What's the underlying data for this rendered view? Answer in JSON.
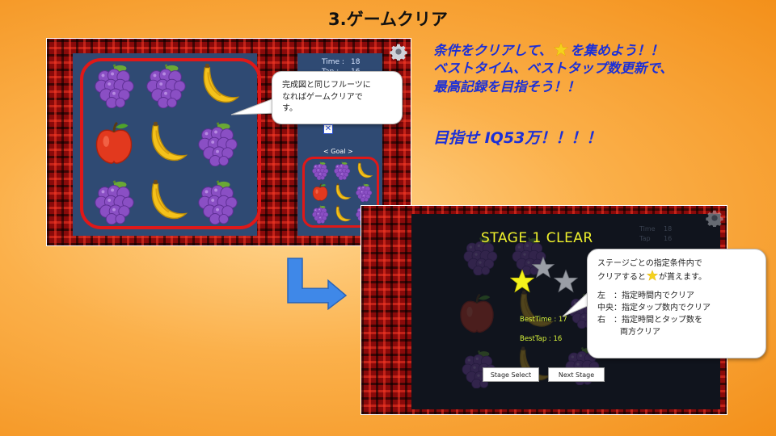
{
  "slide": {
    "title": "3.ゲームクリア",
    "tagline": {
      "line1_a": "条件をクリアして、",
      "line1_b": "を集めよう！！",
      "line2": "ベストタイム、ベストタップ数更新で、",
      "line3": "最高記録を目指そう！！",
      "line4": "目指せ IQ53万！！！！"
    },
    "colors": {
      "tagline": "#1b2fd8",
      "background": "#f7a12e",
      "highlight_ring": "#e01818",
      "star_gold": "#f4e21c"
    }
  },
  "game_screen": {
    "time_label": "Time :",
    "time_value": "18",
    "tap_label": "Tap :",
    "tap_value": "16",
    "goal_label": "< Goal >",
    "board": [
      [
        "grape",
        "grape",
        "banana"
      ],
      [
        "apple",
        "banana",
        "grape"
      ],
      [
        "grape",
        "banana",
        "grape"
      ]
    ],
    "goal": [
      [
        "grape",
        "grape",
        "banana"
      ],
      [
        "apple",
        "banana",
        "grape"
      ],
      [
        "grape",
        "banana",
        "grape"
      ]
    ],
    "settings_icon": "gear-icon",
    "callout": {
      "line1": "完成図と同じフルーツに",
      "line2": "なればゲームクリアで",
      "line3": "す。"
    }
  },
  "clear_screen": {
    "stage_clear": "STAGE 1  CLEAR",
    "best_time_label": "BestTime : 17",
    "best_tap_label": "BestTap  : 16",
    "stage_select_button": "Stage Select",
    "next_stage_button": "Next Stage",
    "stars": {
      "left": "earned",
      "center": "not-earned",
      "right": "not-earned"
    },
    "bg_time": "Time",
    "bg_time_value": "18",
    "bg_tap": "Tap",
    "bg_tap_value": "16",
    "callout": {
      "line1": "ステージごとの指定条件内で",
      "line2_a": "クリアすると",
      "line2_b": "が貰えます。",
      "left_label": "左　：指定時間内でクリア",
      "center_label": "中央：指定タップ数内でクリア",
      "right_label_1": "右　：指定時間とタップ数を",
      "right_label_2": "両方クリア"
    }
  }
}
